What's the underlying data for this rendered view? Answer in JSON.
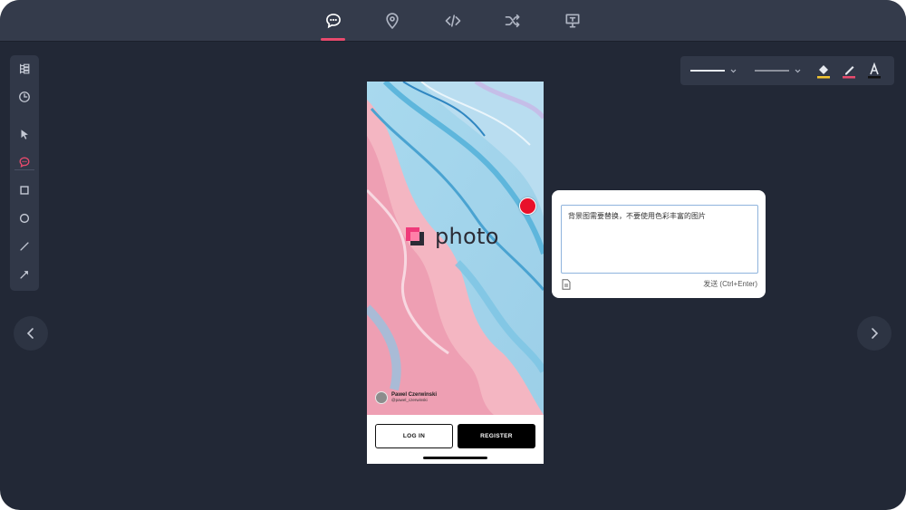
{
  "topbar": {
    "tabs": [
      {
        "icon": "comment-icon",
        "active": true
      },
      {
        "icon": "location-pin-icon",
        "active": false
      },
      {
        "icon": "code-icon",
        "active": false
      },
      {
        "icon": "shuffle-icon",
        "active": false
      },
      {
        "icon": "presentation-icon",
        "active": false
      }
    ],
    "active_color": "#e84a6d"
  },
  "left_toolbar": {
    "tools": [
      "layers-icon",
      "history-icon",
      "pointer-icon",
      "comment-tool-icon",
      "rectangle-icon",
      "circle-icon",
      "line-icon",
      "arrow-icon"
    ],
    "active_tool": "comment-tool-icon"
  },
  "right_toolbar": {
    "items": [
      "stroke-width-dropdown",
      "stroke-style-dropdown",
      "fill-color-icon",
      "stroke-color-icon",
      "text-color-icon"
    ],
    "fill_color": "#f2c531",
    "stroke_color": "#e84a6d",
    "text_color": "#111111"
  },
  "phone": {
    "logo_text": "photo",
    "author_name": "Pawel Czerwinski",
    "author_handle": "@pawel_czerwinski",
    "login_label": "LOG IN",
    "register_label": "REGISTER"
  },
  "comment": {
    "text": "背景图需要替换，不要使用色彩丰富的图片",
    "send_label": "发送 (Ctrl+Enter)",
    "pin_color": "#e8102a"
  }
}
